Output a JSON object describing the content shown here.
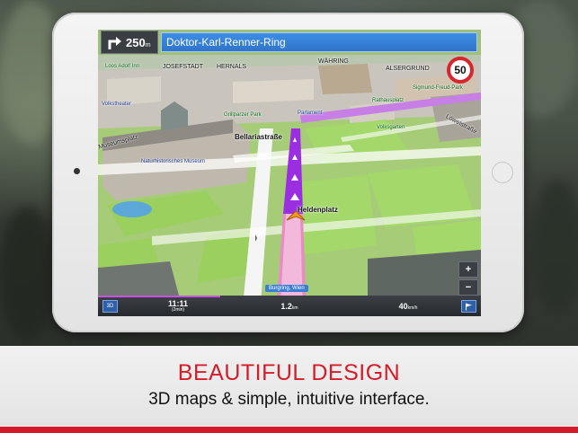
{
  "navigation": {
    "next_turn_distance_value": "250",
    "next_turn_distance_unit": "m",
    "next_turn_icon": "turn-right-arrow-icon",
    "current_street": "Doktor-Karl-Renner-Ring",
    "speed_limit": "50"
  },
  "map_labels": {
    "josefstadt": "JOSEFSTADT",
    "hernals": "HERNALS",
    "waehring": "WÄHRING",
    "alsergrund": "ALSERGRUND",
    "loos": "Loos Adolf Inn",
    "theater": "Volkstheater",
    "parlament": "Parlament",
    "rathaus": "Rathausplatz",
    "freud": "Sigmund-Freud-Park",
    "volksgarten": "Volksgarten",
    "loewelstrasse": "Löwelstraße",
    "bellariastrasse": "Bellariastraße",
    "museumsplatz": "Museumsplatz",
    "naturhistorisches": "Naturhistorisches Museum",
    "grillparzer": "Grillparzer Park",
    "heldenplatz": "Heldenplatz"
  },
  "destination_label": "Burgring, Wien",
  "controls": {
    "zoom_in": "+",
    "zoom_out": "−",
    "view_mode": "3D"
  },
  "trip_info": {
    "arrival_time": "11:11",
    "arrival_sub": "(2min)",
    "distance_value": "1.2",
    "distance_unit": "km",
    "speed_value": "40",
    "speed_unit": "km/h",
    "route_progress": 0.32
  },
  "caption": {
    "headline": "BEAUTIFUL DESIGN",
    "tagline": "3D maps & simple, intuitive interface."
  },
  "colors": {
    "brand_red": "#d41c2a",
    "route_purple": "#9b2ee0",
    "street_bar_blue": "#2f74c9"
  }
}
